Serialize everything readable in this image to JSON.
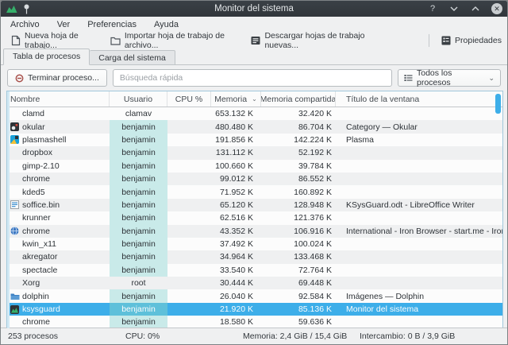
{
  "window": {
    "title": "Monitor del sistema"
  },
  "titlebar": {
    "help_glyph": "?",
    "close_glyph": "✕"
  },
  "menubar": {
    "items": [
      "Archivo",
      "Ver",
      "Preferencias",
      "Ayuda"
    ]
  },
  "toolbar": {
    "buttons": [
      {
        "label": "Nueva hoja de trabajo...",
        "icon": "new-worksheet-icon"
      },
      {
        "label": "Importar hoja de trabajo de archivo...",
        "icon": "import-worksheet-icon"
      },
      {
        "label": "Descargar hojas de trabajo nuevas...",
        "icon": "download-worksheets-icon"
      },
      {
        "label": "Propiedades",
        "icon": "properties-icon"
      }
    ]
  },
  "tabs": [
    {
      "label": "Tabla de procesos",
      "active": true
    },
    {
      "label": "Carga del sistema",
      "active": false
    }
  ],
  "controls": {
    "end_process_label": "Terminar proceso...",
    "search_placeholder": "Búsqueda rápida",
    "filter_value": "Todos los procesos"
  },
  "table": {
    "columns": [
      {
        "key": "name",
        "label": "Nombre"
      },
      {
        "key": "user",
        "label": "Usuario"
      },
      {
        "key": "cpu",
        "label": "CPU %"
      },
      {
        "key": "mem",
        "label": "Memoria",
        "sorted": "desc"
      },
      {
        "key": "shared",
        "label": "Memoria compartida"
      },
      {
        "key": "title",
        "label": "Título de la ventana"
      }
    ],
    "rows": [
      {
        "name": "clamd",
        "icon": null,
        "user": "clamav",
        "user_highlight": false,
        "cpu": "",
        "mem": "653.132 K",
        "shared": "32.420 K",
        "title": "",
        "selected": false
      },
      {
        "name": "okular",
        "icon": "okular-icon",
        "user": "benjamin",
        "user_highlight": true,
        "cpu": "",
        "mem": "480.480 K",
        "shared": "86.704 K",
        "title": "Category — Okular",
        "selected": false
      },
      {
        "name": "plasmashell",
        "icon": "plasma-icon",
        "user": "benjamin",
        "user_highlight": true,
        "cpu": "",
        "mem": "191.856 K",
        "shared": "142.224 K",
        "title": "Plasma",
        "selected": false
      },
      {
        "name": "dropbox",
        "icon": null,
        "user": "benjamin",
        "user_highlight": true,
        "cpu": "",
        "mem": "131.112 K",
        "shared": "52.192 K",
        "title": "",
        "selected": false
      },
      {
        "name": "gimp-2.10",
        "icon": null,
        "user": "benjamin",
        "user_highlight": true,
        "cpu": "",
        "mem": "100.660 K",
        "shared": "39.784 K",
        "title": "",
        "selected": false
      },
      {
        "name": "chrome",
        "icon": null,
        "user": "benjamin",
        "user_highlight": true,
        "cpu": "",
        "mem": "99.012 K",
        "shared": "86.552 K",
        "title": "",
        "selected": false
      },
      {
        "name": "kded5",
        "icon": null,
        "user": "benjamin",
        "user_highlight": true,
        "cpu": "",
        "mem": "71.952 K",
        "shared": "160.892 K",
        "title": "",
        "selected": false
      },
      {
        "name": "soffice.bin",
        "icon": "writer-icon",
        "user": "benjamin",
        "user_highlight": true,
        "cpu": "",
        "mem": "65.120 K",
        "shared": "128.948 K",
        "title": "KSysGuard.odt - LibreOffice Writer",
        "selected": false
      },
      {
        "name": "krunner",
        "icon": null,
        "user": "benjamin",
        "user_highlight": true,
        "cpu": "",
        "mem": "62.516 K",
        "shared": "121.376 K",
        "title": "",
        "selected": false
      },
      {
        "name": "chrome",
        "icon": "browser-icon",
        "user": "benjamin",
        "user_highlight": true,
        "cpu": "",
        "mem": "43.352 K",
        "shared": "106.916 K",
        "title": "International - Iron Browser - start.me - Iron",
        "selected": false
      },
      {
        "name": "kwin_x11",
        "icon": null,
        "user": "benjamin",
        "user_highlight": true,
        "cpu": "",
        "mem": "37.492 K",
        "shared": "100.024 K",
        "title": "",
        "selected": false
      },
      {
        "name": "akregator",
        "icon": null,
        "user": "benjamin",
        "user_highlight": true,
        "cpu": "",
        "mem": "34.964 K",
        "shared": "133.468 K",
        "title": "",
        "selected": false
      },
      {
        "name": "spectacle",
        "icon": null,
        "user": "benjamin",
        "user_highlight": true,
        "cpu": "",
        "mem": "33.540 K",
        "shared": "72.764 K",
        "title": "",
        "selected": false
      },
      {
        "name": "Xorg",
        "icon": null,
        "user": "root",
        "user_highlight": false,
        "cpu": "",
        "mem": "30.444 K",
        "shared": "69.448 K",
        "title": "",
        "selected": false
      },
      {
        "name": "dolphin",
        "icon": "dolphin-icon",
        "user": "benjamin",
        "user_highlight": true,
        "cpu": "",
        "mem": "26.040 K",
        "shared": "92.584 K",
        "title": "Imágenes — Dolphin",
        "selected": false
      },
      {
        "name": "ksysguard",
        "icon": "ksysguard-icon",
        "user": "benjamin",
        "user_highlight": true,
        "cpu": "",
        "mem": "21.920 K",
        "shared": "85.136 K",
        "title": "Monitor del sistema",
        "selected": true
      },
      {
        "name": "chrome",
        "icon": null,
        "user": "benjamin",
        "user_highlight": true,
        "cpu": "",
        "mem": "18.580 K",
        "shared": "59.636 K",
        "title": "",
        "selected": false
      }
    ]
  },
  "statusbar": {
    "items": [
      "253 procesos",
      "CPU: 0%",
      "Memoria: 2,4 GiB / 15,4 GiB",
      "Intercambio: 0 B / 3,9 GiB"
    ]
  },
  "colors": {
    "accent": "#3daee9",
    "titlebar_bg": "#31363b",
    "window_bg": "#eff0f1",
    "view_bg": "#fcfcfc",
    "alt_row": "#eff0f1",
    "user_highlight": "#c9eae9",
    "selection_text": "#fcfcfc"
  }
}
